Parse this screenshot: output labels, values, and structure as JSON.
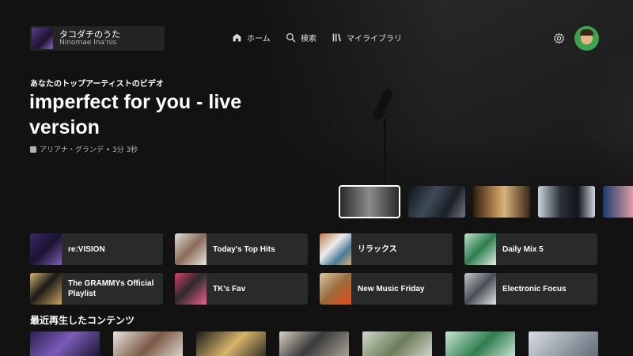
{
  "header": {
    "profile": {
      "title": "タコダチのうた",
      "subtitle": "Ninomae Ina'nis"
    },
    "nav": [
      {
        "label": "ホーム",
        "icon": "home-icon"
      },
      {
        "label": "検索",
        "icon": "search-icon"
      },
      {
        "label": "マイライブラリ",
        "icon": "library-icon"
      }
    ],
    "settings_icon": "gear-icon"
  },
  "hero": {
    "kicker": "あなたのトップアーティストのビデオ",
    "title": "imperfect for you - live version",
    "meta": "アリアナ・グランデ • 3分 3秒"
  },
  "shortcuts": [
    {
      "label": "re:VISION"
    },
    {
      "label": "Today's Top Hits"
    },
    {
      "label": "リラックス"
    },
    {
      "label": "Daily Mix 5"
    },
    {
      "label": "The GRAMMYs Official Playlist"
    },
    {
      "label": "TK's Fav"
    },
    {
      "label": "New Music Friday"
    },
    {
      "label": "Electronic Focus"
    }
  ],
  "recent": {
    "title": "最近再生したコンテンツ"
  },
  "colors": {
    "background": "#121212",
    "card": "#2a2a2a",
    "accent_avatar": "#3fa34d"
  }
}
